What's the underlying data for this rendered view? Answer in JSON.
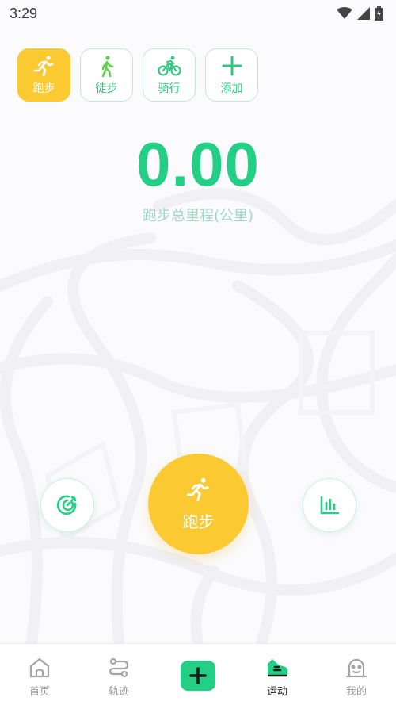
{
  "status_bar": {
    "time": "3:29"
  },
  "sport_tabs": [
    {
      "label": "跑步",
      "icon": "running-icon",
      "active": true
    },
    {
      "label": "徒步",
      "icon": "walking-icon",
      "active": false
    },
    {
      "label": "骑行",
      "icon": "cycling-icon",
      "active": false
    },
    {
      "label": "添加",
      "icon": "plus-icon",
      "active": false
    }
  ],
  "summary": {
    "distance_value": "0.00",
    "distance_label": "跑步总里程(公里)"
  },
  "actions": {
    "goal_icon": "target-icon",
    "start_label": "跑步",
    "start_icon": "running-icon",
    "stats_icon": "bar-chart-icon"
  },
  "bottom_nav": {
    "items": [
      {
        "label": "首页",
        "icon": "home-icon",
        "active": false
      },
      {
        "label": "轨迹",
        "icon": "route-icon",
        "active": false
      },
      {
        "label": "",
        "icon": "add-icon",
        "active": false
      },
      {
        "label": "运动",
        "icon": "sport-shoe-icon",
        "active": true
      },
      {
        "label": "我的",
        "icon": "profile-icon",
        "active": false
      }
    ]
  },
  "colors": {
    "accent_green": "#22cf84",
    "accent_yellow": "#fbc932",
    "label_green": "#9ed8c3",
    "background": "#fbfbfd"
  }
}
